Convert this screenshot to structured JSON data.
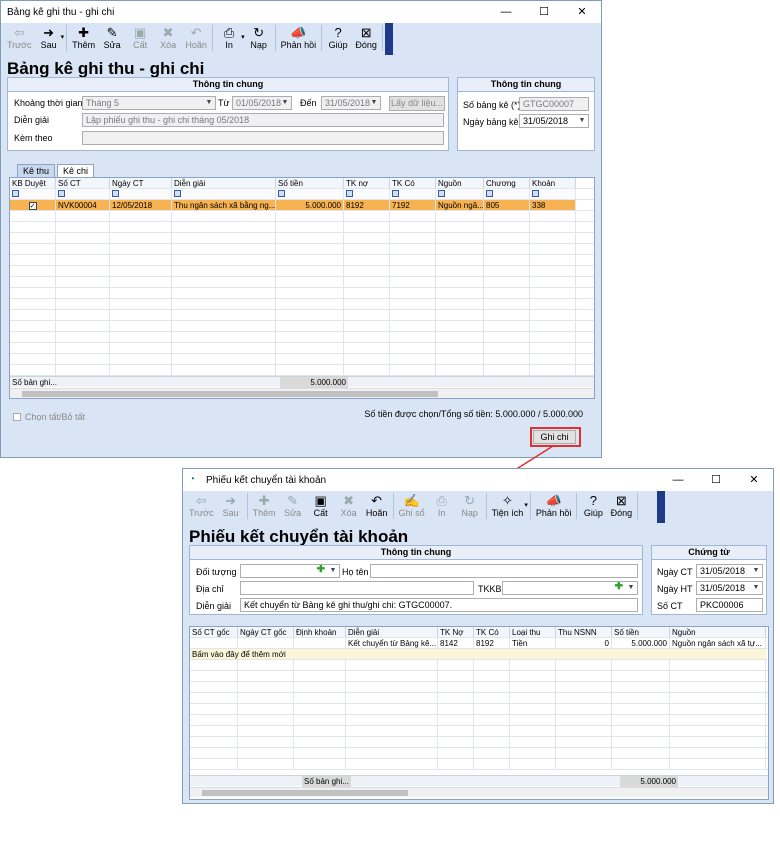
{
  "w1": {
    "title": "Bảng kê ghi thu - ghi chi",
    "toolbar": [
      {
        "label": "Trước",
        "icon": "arrow-left-icon",
        "glyph": "⇦",
        "enabled": false
      },
      {
        "label": "Sau",
        "icon": "arrow-right-icon",
        "glyph": "➜",
        "enabled": true,
        "caret": true
      },
      {
        "label": "Thêm",
        "icon": "add-icon",
        "glyph": "✚",
        "enabled": true
      },
      {
        "label": "Sửa",
        "icon": "edit-icon",
        "glyph": "✎",
        "enabled": true
      },
      {
        "label": "Cất",
        "icon": "save-icon",
        "glyph": "▣",
        "enabled": false
      },
      {
        "label": "Xóa",
        "icon": "delete-icon",
        "glyph": "✖",
        "enabled": false
      },
      {
        "label": "Hoãn",
        "icon": "undo-icon",
        "glyph": "↶",
        "enabled": false
      },
      {
        "label": "In",
        "icon": "print-icon",
        "glyph": "⎙",
        "enabled": true,
        "caret": true
      },
      {
        "label": "Nạp",
        "icon": "reload-icon",
        "glyph": "↻",
        "enabled": true
      },
      {
        "label": "Phản hồi",
        "icon": "feedback-icon",
        "glyph": "📣",
        "enabled": true
      },
      {
        "label": "Giúp",
        "icon": "help-icon",
        "glyph": "?",
        "enabled": true
      },
      {
        "label": "Đóng",
        "icon": "close-icon",
        "glyph": "⊠",
        "enabled": true
      }
    ],
    "doc_title": "Bảng kê ghi thu - ghi chi",
    "general": {
      "header": "Thông tin chung",
      "period_label": "Khoảng thời gian",
      "period_value": "Tháng 5",
      "from_label": "Từ",
      "from_value": "01/05/2018",
      "to_label": "Đến",
      "to_value": "31/05/2018",
      "fetch_label": "Lấy dữ liệu...",
      "desc_label": "Diễn giải",
      "desc_value": "Lập phiếu ghi thu - ghi chi  tháng 05/2018",
      "attach_label": "Kèm theo",
      "attach_value": ""
    },
    "info": {
      "header": "Thông tin chung",
      "no_label": "Số bảng kê (*)",
      "no_value": "GTGC00007",
      "date_label": "Ngày bảng kê",
      "date_value": "31/05/2018"
    },
    "tabs": [
      "Kê thu",
      "Kê chi"
    ],
    "columns": [
      "KB Duyệt",
      "Số CT",
      "Ngày CT",
      "Diễn giải",
      "Số tiền",
      "TK nợ",
      "TK Có",
      "Nguồn",
      "Chương",
      "Khoản"
    ],
    "rows": [
      {
        "checked": true,
        "so_ct": "NVK00004",
        "ngay_ct": "12/05/2018",
        "dien_giai": "Thu ngân sách xã bằng ng...",
        "so_tien": "5.000.000",
        "tk_no": "8192",
        "tk_co": "7192",
        "nguon": "Nguồn ngâ...",
        "chuong": "805",
        "khoan": "338"
      }
    ],
    "footer_label": "Số bản ghi...",
    "footer_total": "5.000.000",
    "select_all": "Chọn tất/Bỏ tất",
    "summary": "Số tiền được chọn/Tổng số tiền: 5.000.000  / 5.000.000",
    "ghichi_label": "Ghi chi"
  },
  "w2": {
    "title": "Phiếu kết chuyển tài khoản",
    "toolbar": [
      {
        "label": "Trước",
        "icon": "arrow-left-icon",
        "glyph": "⇦",
        "enabled": false
      },
      {
        "label": "Sau",
        "icon": "arrow-right-icon",
        "glyph": "➜",
        "enabled": false
      },
      {
        "label": "Thêm",
        "icon": "add-icon",
        "glyph": "✚",
        "enabled": false
      },
      {
        "label": "Sửa",
        "icon": "edit-icon",
        "glyph": "✎",
        "enabled": false
      },
      {
        "label": "Cất",
        "icon": "save-icon",
        "glyph": "▣",
        "enabled": true
      },
      {
        "label": "Xóa",
        "icon": "delete-icon",
        "glyph": "✖",
        "enabled": false
      },
      {
        "label": "Hoãn",
        "icon": "undo-icon",
        "glyph": "↶",
        "enabled": true
      },
      {
        "label": "Ghi sổ",
        "icon": "post-icon",
        "glyph": "✍",
        "enabled": false
      },
      {
        "label": "In",
        "icon": "print-icon",
        "glyph": "⎙",
        "enabled": false
      },
      {
        "label": "Nạp",
        "icon": "reload-icon",
        "glyph": "↻",
        "enabled": false
      },
      {
        "label": "Tiện ích",
        "icon": "utility-icon",
        "glyph": "✧",
        "enabled": true,
        "caret": true
      },
      {
        "label": "Phản hồi",
        "icon": "feedback-icon",
        "glyph": "📣",
        "enabled": true
      },
      {
        "label": "Giúp",
        "icon": "help-icon",
        "glyph": "?",
        "enabled": true
      },
      {
        "label": "Đóng",
        "icon": "close-icon",
        "glyph": "⊠",
        "enabled": true
      }
    ],
    "doc_title": "Phiếu kết chuyển tài khoản",
    "general": {
      "header": "Thông tin chung",
      "object_label": "Đối tượng",
      "object_value": "",
      "name_label": "Họ tên",
      "name_value": "",
      "address_label": "Địa chỉ",
      "address_value": "",
      "tkkb_label": "TKKB",
      "tkkb_value": "",
      "desc_label": "Diễn giải",
      "desc_value": "Kết chuyển từ Bảng kê ghi thu/ghi chi: GTGC00007."
    },
    "voucher": {
      "header": "Chứng từ",
      "date_ct_label": "Ngày CT",
      "date_ct_value": "31/05/2018",
      "date_ht_label": "Ngày HT",
      "date_ht_value": "31/05/2018",
      "no_label": "Số CT",
      "no_value": "PKC00006"
    },
    "columns": [
      "Số CT gốc",
      "Ngày CT gốc",
      "Định khoản",
      "Diễn giải",
      "TK Nợ",
      "TK Có",
      "Loại thu",
      "Thu NSNN",
      "Số tiền",
      "Nguồn"
    ],
    "rows": [
      {
        "so_ct_goc": "",
        "ngay_ct_goc": "",
        "dinh_khoan": "",
        "dien_giai": "Kết chuyển từ Bảng kê...",
        "tk_no": "8142",
        "tk_co": "8192",
        "loai_thu": "Tiền",
        "thu_nsnn": "0",
        "so_tien": "5.000.000",
        "nguon": "Nguồn ngân sách xã tự..."
      }
    ],
    "new_row": "Bấm vào đây để thêm mới",
    "footer_label": "Số bản ghi...",
    "footer_total": "5.000.000"
  },
  "colors": {
    "accent": "#1e3a8a",
    "selected_row": "#f7b351",
    "highlight_box": "#e03030",
    "arrow": "#e03030"
  }
}
